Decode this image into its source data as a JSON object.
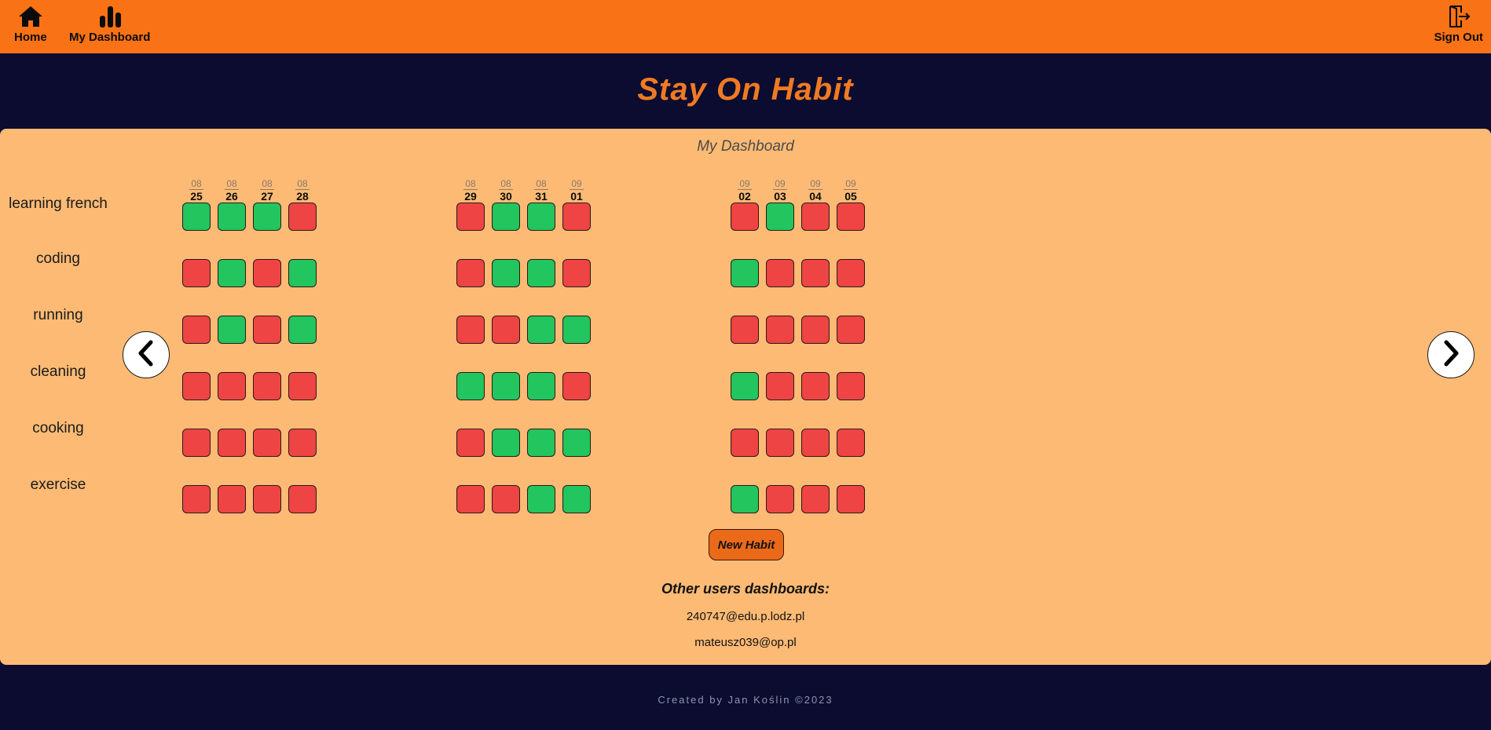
{
  "nav": {
    "home_label": "Home",
    "dashboard_label": "My Dashboard",
    "signout_label": "Sign Out",
    "home_icon": "home-icon",
    "dashboard_icon": "bar-chart-icon",
    "signout_icon": "door-exit-icon"
  },
  "app_title": "Stay On Habit",
  "dashboard": {
    "title": "My Dashboard",
    "weeks": [
      {
        "dates": [
          {
            "month": "08",
            "day": "25"
          },
          {
            "month": "08",
            "day": "26"
          },
          {
            "month": "08",
            "day": "27"
          },
          {
            "month": "08",
            "day": "28"
          }
        ]
      },
      {
        "dates": [
          {
            "month": "08",
            "day": "29"
          },
          {
            "month": "08",
            "day": "30"
          },
          {
            "month": "08",
            "day": "31"
          },
          {
            "month": "09",
            "day": "01"
          }
        ]
      },
      {
        "dates": [
          {
            "month": "09",
            "day": "02"
          },
          {
            "month": "09",
            "day": "03"
          },
          {
            "month": "09",
            "day": "04"
          },
          {
            "month": "09",
            "day": "05"
          }
        ]
      }
    ],
    "habits": [
      {
        "name": "learning french",
        "status": [
          [
            1,
            1,
            1,
            0
          ],
          [
            0,
            1,
            1,
            0
          ],
          [
            0,
            1,
            0,
            0
          ]
        ]
      },
      {
        "name": "coding",
        "status": [
          [
            0,
            1,
            0,
            1
          ],
          [
            0,
            1,
            1,
            0
          ],
          [
            1,
            0,
            0,
            0
          ]
        ]
      },
      {
        "name": "running",
        "status": [
          [
            0,
            1,
            0,
            1
          ],
          [
            0,
            0,
            1,
            1
          ],
          [
            0,
            0,
            0,
            0
          ]
        ]
      },
      {
        "name": "cleaning",
        "status": [
          [
            0,
            0,
            0,
            0
          ],
          [
            1,
            1,
            1,
            0
          ],
          [
            1,
            0,
            0,
            0
          ]
        ]
      },
      {
        "name": "cooking",
        "status": [
          [
            0,
            0,
            0,
            0
          ],
          [
            0,
            1,
            1,
            1
          ],
          [
            0,
            0,
            0,
            0
          ]
        ]
      },
      {
        "name": "exercise",
        "status": [
          [
            0,
            0,
            0,
            0
          ],
          [
            0,
            0,
            1,
            1
          ],
          [
            1,
            0,
            0,
            0
          ]
        ]
      }
    ],
    "colors": {
      "done": "#22c55e",
      "missed": "#ef4444"
    },
    "prev_icon": "chevron-left-icon",
    "next_icon": "chevron-right-icon",
    "new_habit_label": "New Habit"
  },
  "others": {
    "title": "Other users dashboards:",
    "users": [
      "240747@edu.p.lodz.pl",
      "mateusz039@op.pl"
    ]
  },
  "footer": "Created by Jan Koślin ©2023"
}
